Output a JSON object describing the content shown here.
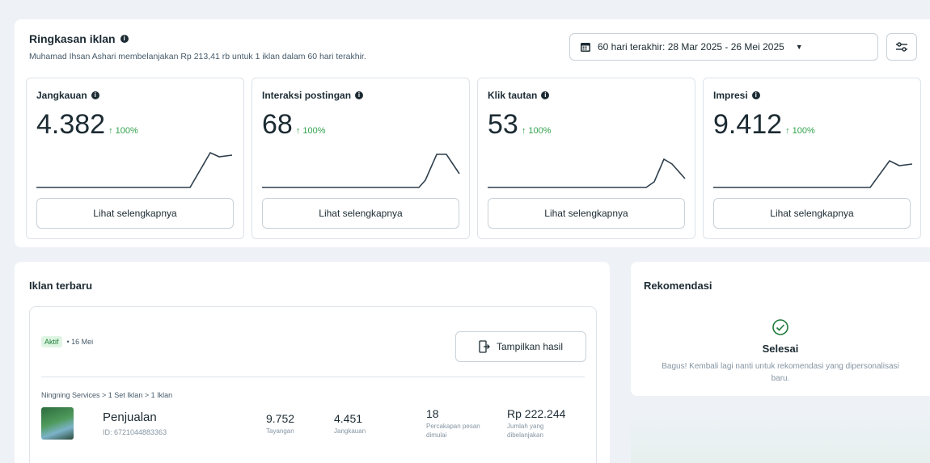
{
  "summary": {
    "title": "Ringkasan iklan",
    "subtitle": "Muhamad Ihsan Ashari membelanjakan Rp 213,41 rb untuk 1 iklan dalam 60 hari terakhir.",
    "date_range": "60 hari terakhir: 28 Mar 2025 - 26 Mei 2025"
  },
  "metrics": [
    {
      "label": "Jangkauan",
      "value": "4.382",
      "change": "↑ 100%",
      "cta": "Lihat selengkapnya"
    },
    {
      "label": "Interaksi postingan",
      "value": "68",
      "change": "↑ 100%",
      "cta": "Lihat selengkapnya"
    },
    {
      "label": "Klik tautan",
      "value": "53",
      "change": "↑ 100%",
      "cta": "Lihat selengkapnya"
    },
    {
      "label": "Impresi",
      "value": "9.412",
      "change": "↑ 100%",
      "cta": "Lihat selengkapnya"
    }
  ],
  "latest": {
    "title": "Iklan terbaru",
    "status": "Aktif",
    "date": "• 16 Mei",
    "results_btn": "Tampilkan hasil",
    "breadcrumb": "Ningning Services > 1 Set Iklan > 1 Iklan",
    "ad_name": "Penjualan",
    "ad_id": "ID: 6721044883363",
    "stats": [
      {
        "value": "9.752",
        "label": "Tayangan"
      },
      {
        "value": "4.451",
        "label": "Jangkauan"
      },
      {
        "value": "18",
        "label": "Percakapan pesan dimulai"
      },
      {
        "value": "Rp 222.244",
        "label": "Jumlah yang dibelanjakan"
      }
    ]
  },
  "recommendations": {
    "title": "Rekomendasi",
    "done": "Selesai",
    "message": "Bagus! Kembali lagi nanti untuk rekomendasi yang dipersonalisasi baru."
  },
  "colors": {
    "accent_green": "#31a24c",
    "sparkline": "#2e3f4c"
  }
}
